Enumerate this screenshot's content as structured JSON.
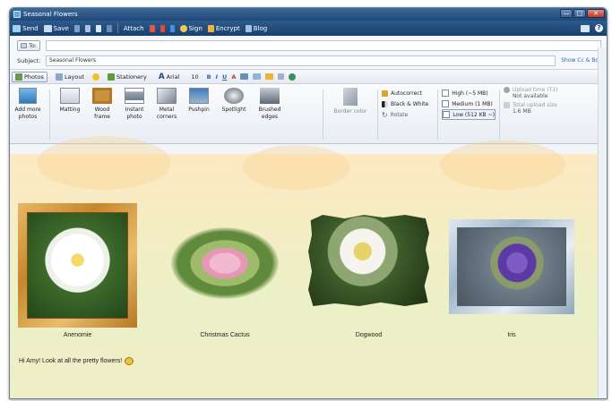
{
  "window": {
    "title": "Seasonal Flowers",
    "minimize": "—",
    "maximize": "□",
    "close": "✕"
  },
  "commandbar": {
    "send": "Send",
    "save": "Save",
    "attach": "Attach",
    "sign": "Sign",
    "encrypt": "Encrypt",
    "blog": "Blog"
  },
  "address": {
    "to_label": "To:",
    "to_value": "",
    "subject_label": "Subject:",
    "subject_value": "Seasonal Flowers",
    "show_cc": "Show Cc & Bcc"
  },
  "formatbar": {
    "photos": "Photos",
    "layout": "Layout",
    "stationery": "Stationery",
    "font": "Arial",
    "size": "10",
    "bold": "B",
    "italic": "I",
    "underline": "U",
    "font_color": "A"
  },
  "ribbon": {
    "add_more": "Add more photos",
    "styles": [
      "Matting",
      "Wood frame",
      "Instant photo",
      "Metal corners",
      "Pushpin",
      "Spotlight",
      "Brushed edges"
    ],
    "border_color": "Border color",
    "autocorrect": "Autocorrect",
    "black_white": "Black & White",
    "rotate": "Rotate",
    "quality_high": "High (~5 MB)",
    "quality_medium": "Medium (1 MB)",
    "quality_low": "Low (512 KB ~)",
    "upload_time_label": "Upload time (T1)",
    "upload_time_value": "Not available",
    "total_upload_label": "Total upload size",
    "total_upload_value": "1.6 MB"
  },
  "photos": [
    {
      "caption": "Anenomie"
    },
    {
      "caption": "Christmas Cactus"
    },
    {
      "caption": "Dogwood"
    },
    {
      "caption": "Iris"
    }
  ],
  "message": "Hi Amy! Look at all the pretty flowers!",
  "colors": {
    "titlebar": "#1f4778",
    "link": "#2a66b5",
    "canvas": "#f1eec6"
  }
}
